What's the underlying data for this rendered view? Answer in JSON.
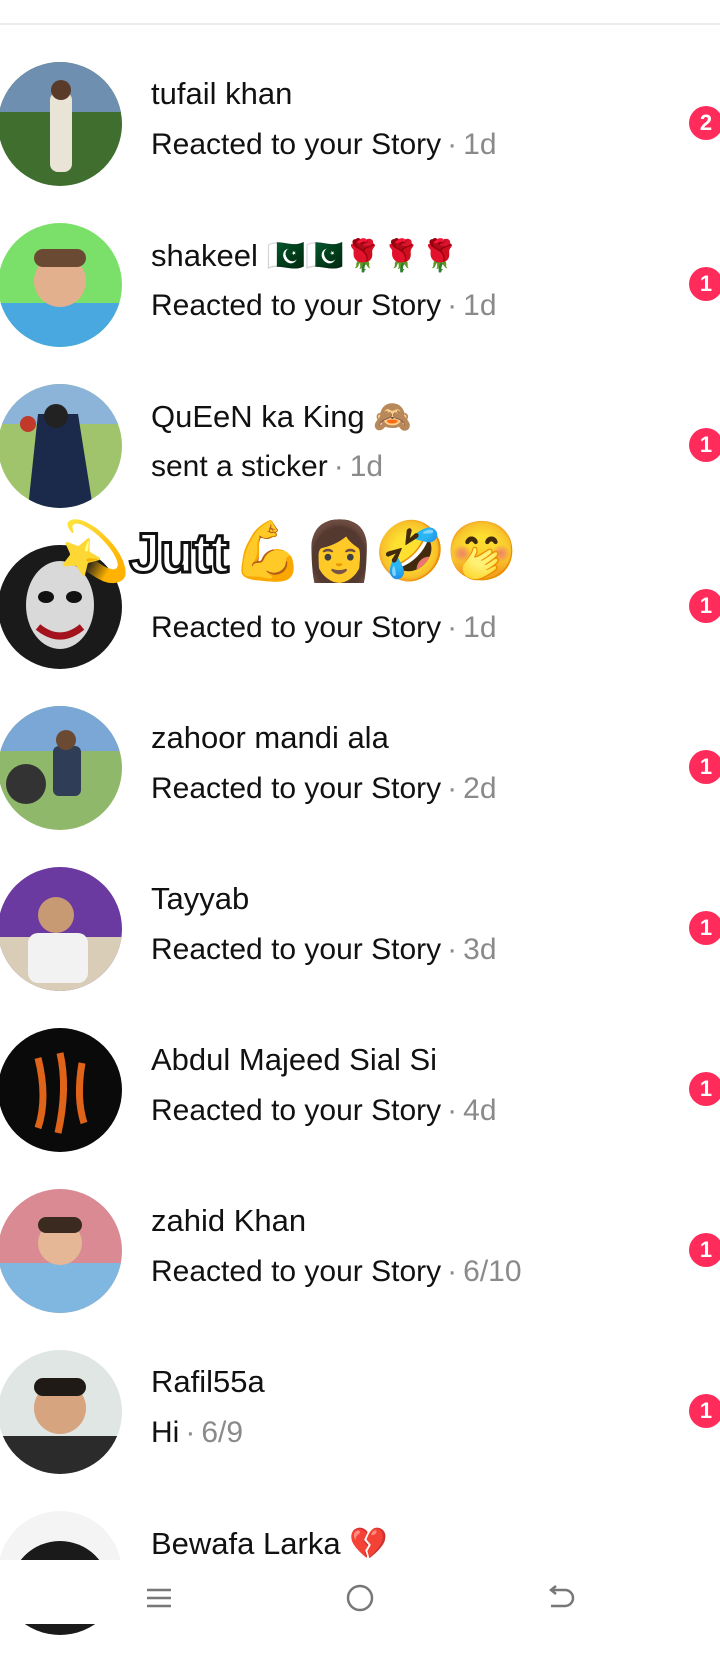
{
  "conversations": [
    {
      "name": "tufail khan",
      "subtitle": "Reacted to your Story",
      "time": "1d",
      "badge": "2"
    },
    {
      "name": "shakeel 🇵🇰🇵🇰🌹🌹🌹",
      "subtitle": "Reacted to your Story",
      "time": "1d",
      "badge": "1"
    },
    {
      "name": "QuEeN ka King 🙈",
      "subtitle": "sent a sticker",
      "time": "1d",
      "badge": "1"
    },
    {
      "name": "",
      "subtitle": "Reacted to your Story",
      "time": "1d",
      "badge": "1"
    },
    {
      "name": "zahoor mandi ala",
      "subtitle": "Reacted to your Story",
      "time": "2d",
      "badge": "1"
    },
    {
      "name": "Tayyab",
      "subtitle": "Reacted to your Story",
      "time": "3d",
      "badge": "1"
    },
    {
      "name": "Abdul Majeed Sial Si",
      "subtitle": "Reacted to your Story",
      "time": "4d",
      "badge": "1"
    },
    {
      "name": "zahid Khan",
      "subtitle": "Reacted to your Story",
      "time": "6/10",
      "badge": "1"
    },
    {
      "name": "Rafil55a",
      "subtitle": "Hi",
      "time": "6/9",
      "badge": "1"
    },
    {
      "name": "Bewafa Larka 💔",
      "subtitle": "",
      "time": "",
      "badge": ""
    }
  ],
  "overlay": {
    "text": "Jutt",
    "lead_emoji": "💫",
    "emojis": "💪👩🤣🤭"
  },
  "colors": {
    "badge": "#ff2b5a",
    "muted": "#8a8a8a"
  },
  "nav": {
    "icons": [
      "menu-icon",
      "home-icon",
      "back-icon"
    ]
  }
}
